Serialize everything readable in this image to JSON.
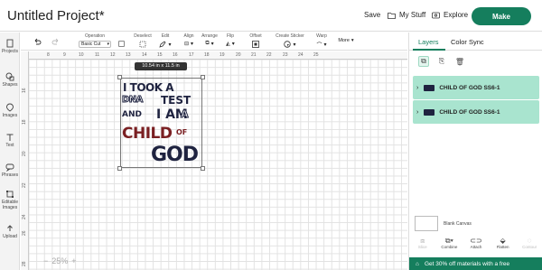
{
  "header": {
    "title": "Untitled Project*",
    "save_label": "Save",
    "mystuff_label": "My Stuff",
    "explore_label": "Explore",
    "make_label": "Make"
  },
  "rail": {
    "items": [
      {
        "label": "Projects",
        "icon": "projects-icon"
      },
      {
        "label": "Shapes",
        "icon": "shapes-icon"
      },
      {
        "label": "Images",
        "icon": "images-icon"
      },
      {
        "label": "Text",
        "icon": "text-icon"
      },
      {
        "label": "Phrases",
        "icon": "phrases-icon"
      },
      {
        "label": "Editable Images",
        "icon": "editable-images-icon"
      },
      {
        "label": "Upload",
        "icon": "upload-icon"
      }
    ]
  },
  "toolbar": {
    "operation_label": "Operation",
    "operation_value": "Basic Cut",
    "deselect_label": "Deselect",
    "edit_label": "Edit",
    "align_label": "Align",
    "arrange_label": "Arrange",
    "flip_label": "Flip",
    "offset_label": "Offset",
    "create_sticker_label": "Create Sticker",
    "warp_label": "Warp",
    "more_label": "More"
  },
  "rulers": {
    "top": [
      "8",
      "9",
      "10",
      "11",
      "12",
      "13",
      "14",
      "15",
      "16",
      "17",
      "18",
      "19",
      "20",
      "21",
      "22",
      "23",
      "24",
      "25"
    ],
    "left": [
      "16",
      "18",
      "20",
      "22",
      "24",
      "26",
      "28"
    ]
  },
  "canvas": {
    "dimension_tooltip": "10.54 in x 11.5 in",
    "design_text": {
      "line1": "I TOOK A",
      "line2a": "DNA",
      "line2b": "TEST",
      "line3a": "AND",
      "line3b": "I AM",
      "line3c": "A",
      "line4a": "CHILD",
      "line4b": "OF",
      "line5": "GOD"
    },
    "zoom": "25%"
  },
  "panel": {
    "tab_layers": "Layers",
    "tab_color_sync": "Color Sync",
    "layers": [
      {
        "name": "CHILD OF GOD SS6-1"
      },
      {
        "name": "CHILD OF GOD SS6-1"
      }
    ],
    "blank_canvas_label": "Blank Canvas",
    "tools": [
      {
        "label": "Slice",
        "enabled": false
      },
      {
        "label": "Combine",
        "enabled": true
      },
      {
        "label": "Attach",
        "enabled": true
      },
      {
        "label": "Flatten",
        "enabled": true
      },
      {
        "label": "Contour",
        "enabled": false
      }
    ],
    "promo_text": "Get 30% off materials with a free"
  },
  "colors": {
    "accent": "#157e5d",
    "layer_highlight": "#a9e4cf",
    "design_navy": "#1f2340",
    "design_red": "#7a1f22"
  }
}
